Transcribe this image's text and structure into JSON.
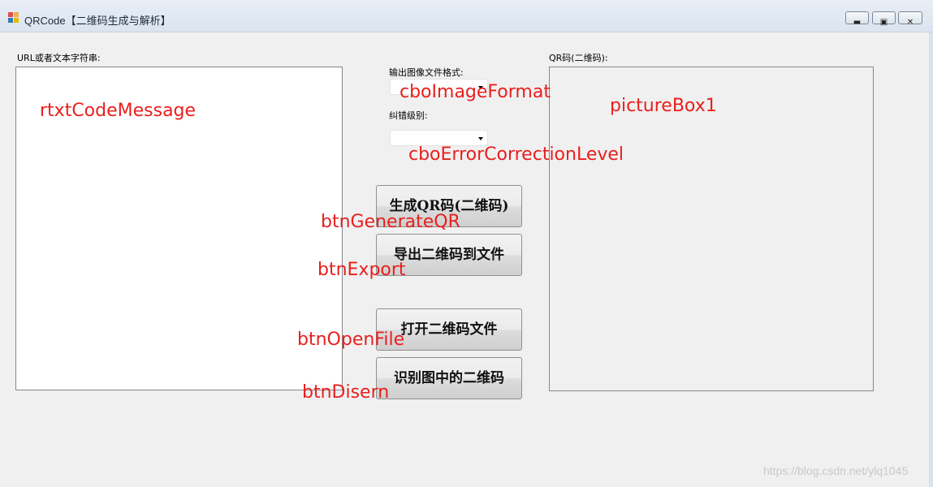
{
  "window": {
    "title": "QRCode【二维码生成与解析】",
    "app_icon": "qrcode-app-icon",
    "controls": {
      "minimize": "minimize-icon",
      "maximize": "maximize-icon",
      "close": "close-icon"
    }
  },
  "labels": {
    "input_label": "URL或者文本字符串:",
    "image_format_label": "输出图像文件格式:",
    "error_level_label": "纠错级别:",
    "qr_label": "QR码(二维码):"
  },
  "inputs": {
    "code_message": {
      "value": ""
    },
    "image_format": {
      "selected": ""
    },
    "error_correction_level": {
      "selected": ""
    }
  },
  "buttons": {
    "generate": "生成QR码(二维码)",
    "export": "导出二维码到文件",
    "open_file": "打开二维码文件",
    "discern": "识别图中的二维码"
  },
  "annotations": {
    "rtxt": "rtxtCodeMessage",
    "cbo_image": "cboImageFormat",
    "picture": "pictureBox1",
    "cbo_error": "cboErrorCorrectionLevel",
    "btn_generate": "btnGenerateQR",
    "btn_export": "btnExport",
    "btn_open": "btnOpenFile",
    "btn_discern": "btnDisern"
  },
  "watermark": "https://blog.csdn.net/ylq1045",
  "colors": {
    "annotation": "#e8201e",
    "window_bg": "#f0f0f0",
    "titlebar": "#dbe4ef"
  }
}
